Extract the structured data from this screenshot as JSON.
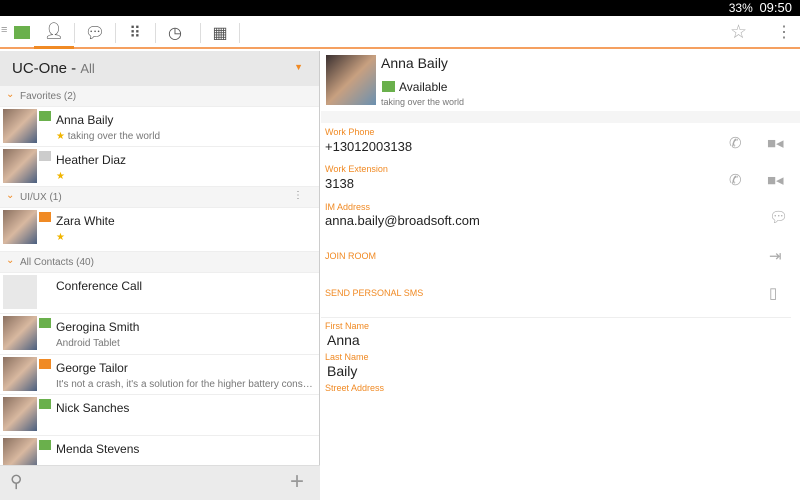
{
  "status_bar": {
    "battery": "33%",
    "time": "09:50"
  },
  "toolbar": {
    "tabs": [
      {
        "icon": "contacts-icon"
      },
      {
        "icon": "chat-icon"
      },
      {
        "icon": "dialpad-icon"
      },
      {
        "icon": "history-icon"
      },
      {
        "icon": "directory-icon"
      }
    ],
    "presence_color": "#6ab04c"
  },
  "left": {
    "title": "UC-One -",
    "filter": "All",
    "sections": [
      {
        "label": "Favorites (2)"
      },
      {
        "label": "UI/UX (1)"
      },
      {
        "label": "All Contacts (40)"
      }
    ],
    "contacts": [
      {
        "name": "Anna Baily",
        "sub": "taking over the world",
        "flag": "#6ab04c",
        "star": "★"
      },
      {
        "name": "Heather Diaz",
        "sub": "",
        "flag": "#cccccc",
        "star": "★"
      },
      {
        "name": "Zara White",
        "sub": "",
        "flag": "#f08a24",
        "star": "★"
      },
      {
        "name": "Conference Call",
        "sub": ""
      },
      {
        "name": "Gerogina Smith",
        "sub": "Android Tablet",
        "flag": "#6ab04c"
      },
      {
        "name": "George Tailor",
        "sub": "It's not a crash, it's a solution for the higher battery consumption",
        "flag": "#f08a24"
      },
      {
        "name": "Nick Sanches",
        "sub": "",
        "flag": "#6ab04c"
      },
      {
        "name": "Menda Stevens",
        "sub": "",
        "flag": "#6ab04c"
      }
    ]
  },
  "detail": {
    "name": "Anna Baily",
    "presence": "Available",
    "status": "taking over the world",
    "work_phone_label": "Work Phone",
    "work_phone": "+13012003138",
    "work_ext_label": "Work Extension",
    "work_ext": "3138",
    "im_label": "IM Address",
    "im": "anna.baily@broadsoft.com",
    "join_room": "JOIN ROOM",
    "send_sms": "SEND PERSONAL SMS",
    "first_name_label": "First Name",
    "first_name": "Anna",
    "last_name_label": "Last Name",
    "last_name": "Baily",
    "street_label": "Street Address"
  },
  "colors": {
    "accent": "#f08a24",
    "available": "#6ab04c"
  }
}
